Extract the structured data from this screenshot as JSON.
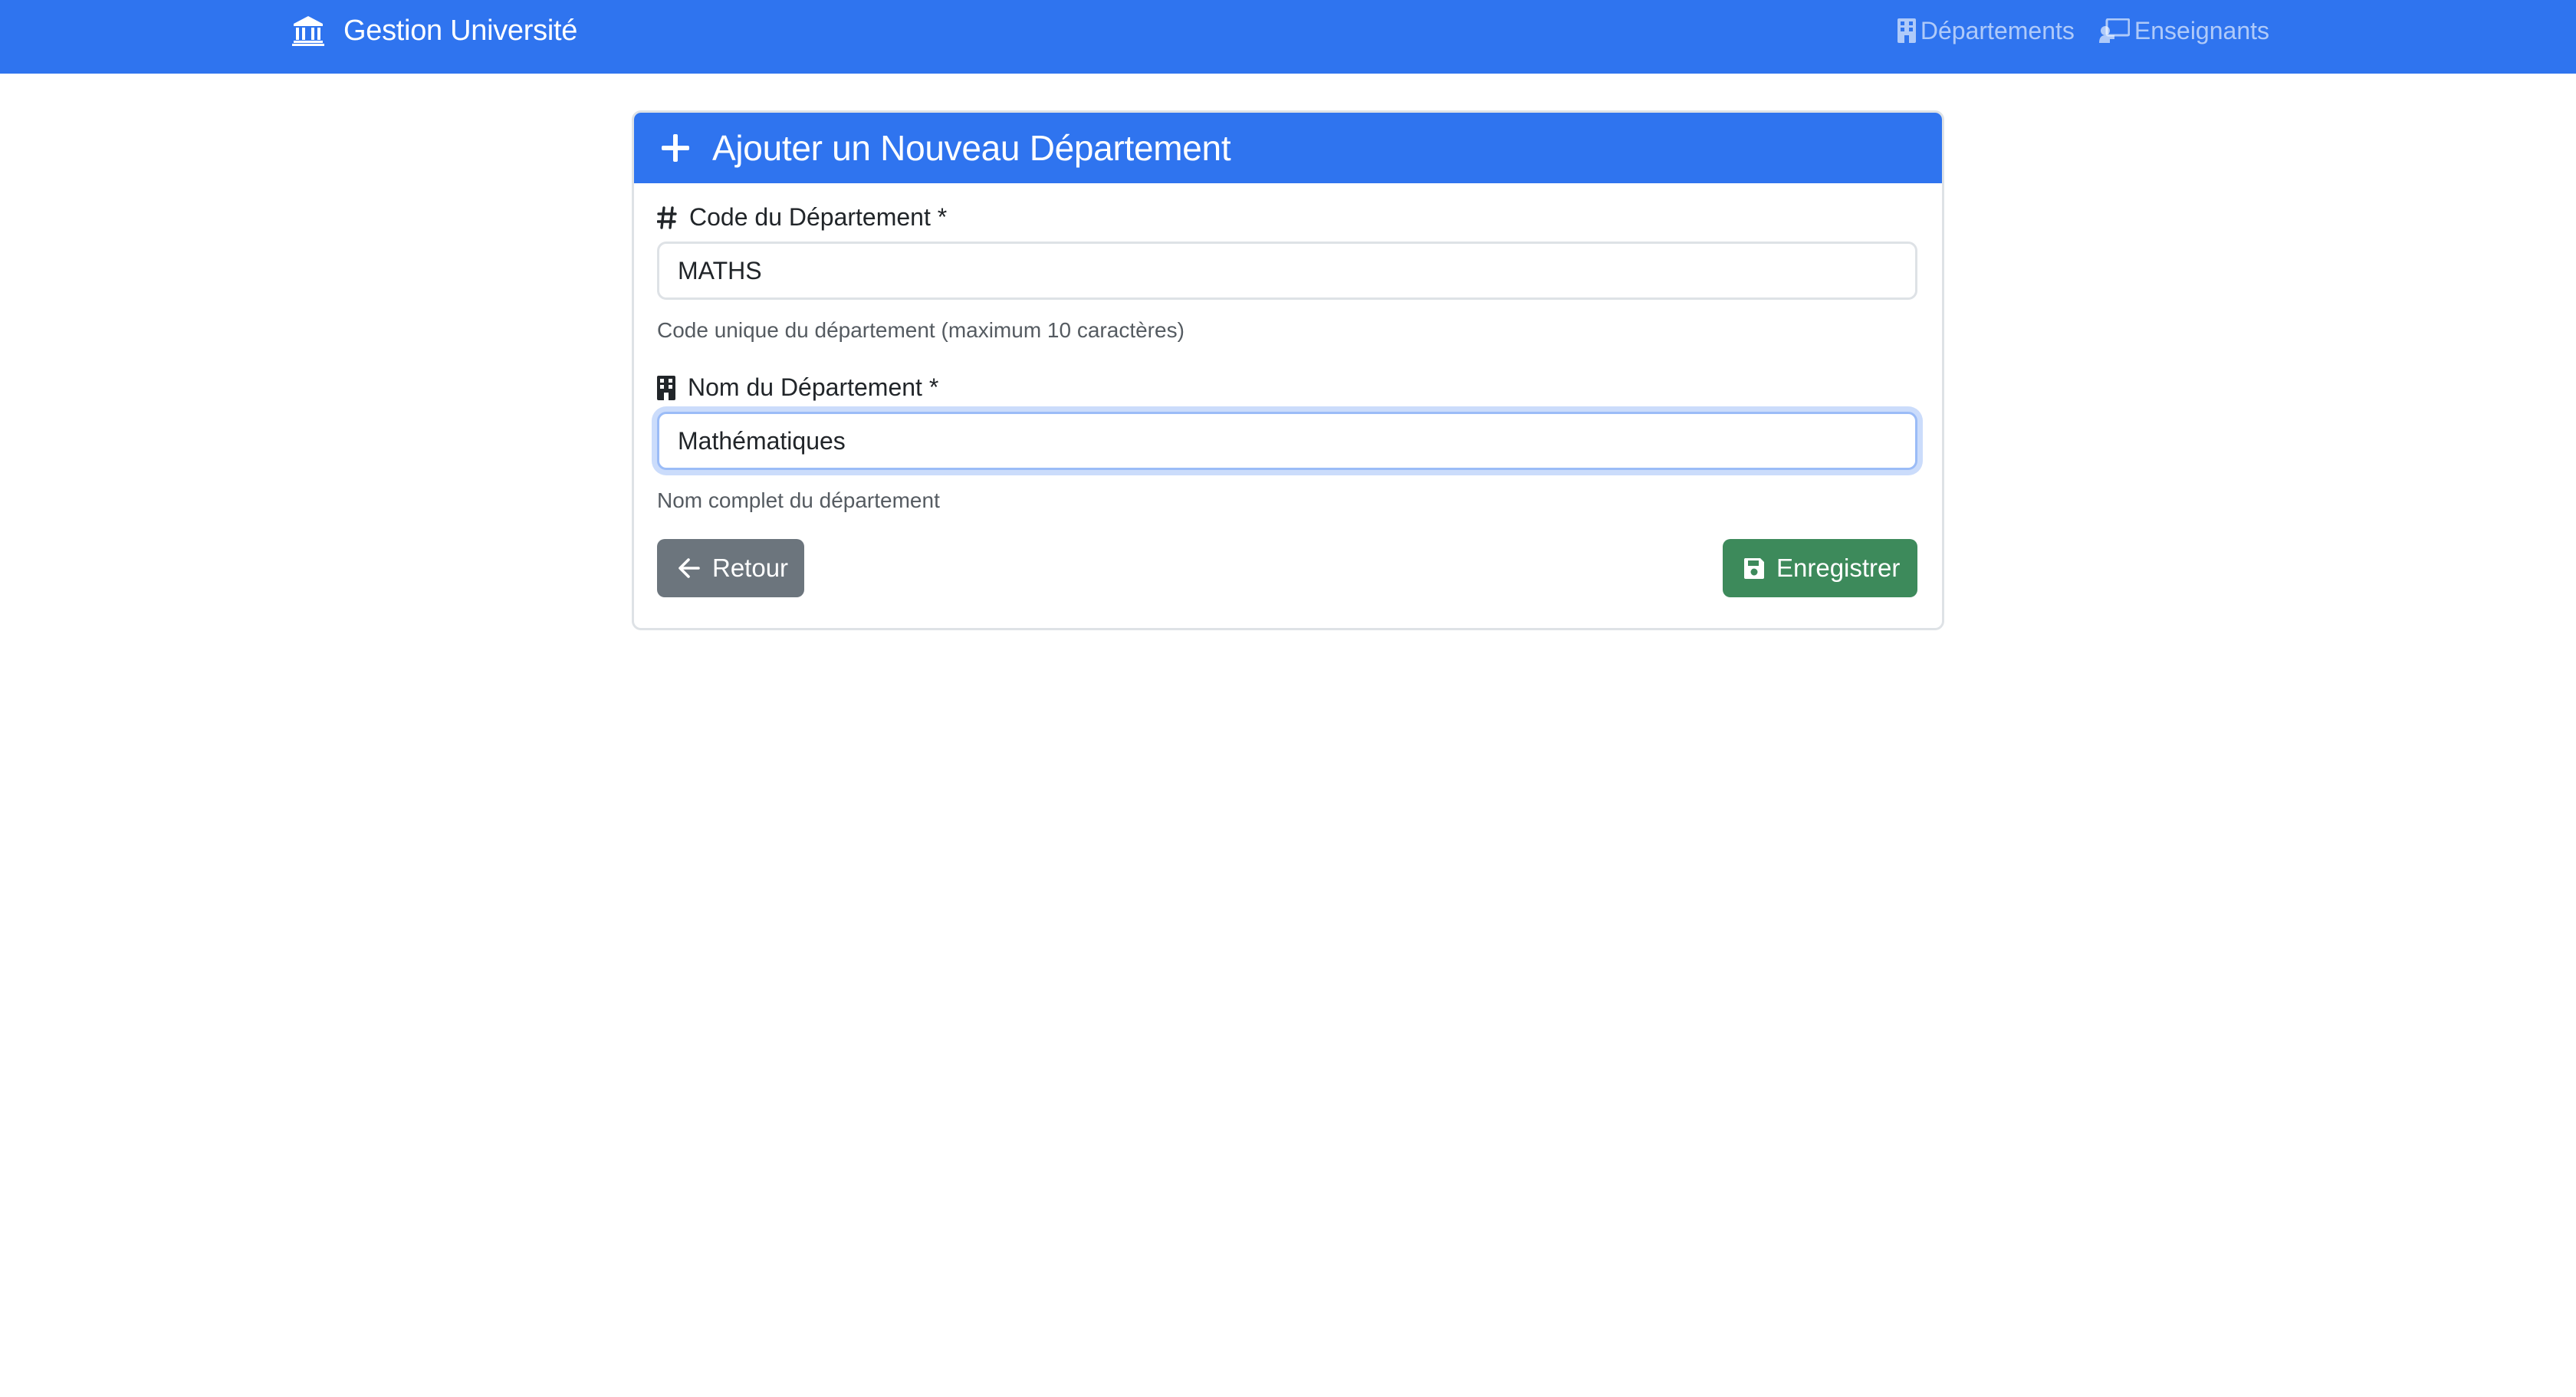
{
  "navbar": {
    "brand": "Gestion Université",
    "brand_icon": "university-building-icon",
    "links": [
      {
        "label": "Départements",
        "icon": "building-icon"
      },
      {
        "label": "Enseignants",
        "icon": "teacher-board-icon"
      }
    ],
    "background_color": "#2f74ef"
  },
  "card": {
    "title": "Ajouter un Nouveau Département",
    "title_icon": "plus-icon",
    "fields": {
      "code": {
        "label": "Code du Département *",
        "icon": "hash-icon",
        "value": "MATHS",
        "help": "Code unique du département (maximum 10 caractères)"
      },
      "name": {
        "label": "Nom du Département *",
        "icon": "building-icon",
        "value": "Mathématiques",
        "help": "Nom complet du département"
      }
    },
    "buttons": {
      "back": {
        "label": "Retour",
        "icon": "arrow-left-icon",
        "color": "#6c757d"
      },
      "save": {
        "label": "Enregistrer",
        "icon": "floppy-disk-icon",
        "color": "#3d8a5b"
      }
    }
  }
}
